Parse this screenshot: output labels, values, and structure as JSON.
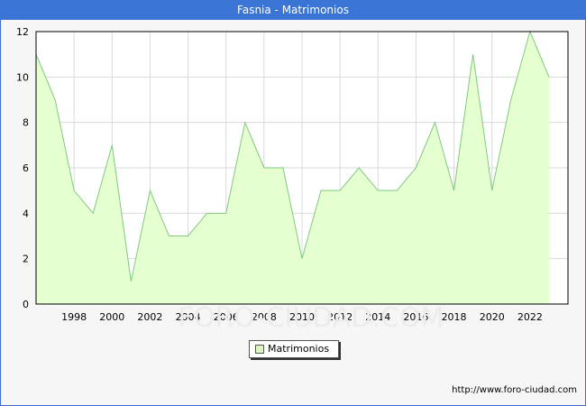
{
  "title": "Fasnia - Matrimonios",
  "source_url": "http://www.foro-ciudad.com",
  "watermark": "FORO-CIUDAD.COM",
  "colors": {
    "title_bg": "#3a75d6",
    "area_fill": "#e6ffd0",
    "area_line": "#80c880",
    "legend_swatch": "#d9f7c0",
    "grid": "#d9d9d9"
  },
  "chart_data": {
    "type": "area",
    "title": "Fasnia - Matrimonios",
    "xlabel": "",
    "ylabel": "",
    "x": [
      1996,
      1997,
      1998,
      1999,
      2000,
      2001,
      2002,
      2003,
      2004,
      2005,
      2006,
      2007,
      2008,
      2009,
      2010,
      2011,
      2012,
      2013,
      2014,
      2015,
      2016,
      2017,
      2018,
      2019,
      2020,
      2021,
      2022,
      2023
    ],
    "series": [
      {
        "name": "Matrimonios",
        "values": [
          11,
          9,
          5,
          4,
          7,
          1,
          5,
          3,
          3,
          4,
          4,
          8,
          6,
          6,
          2,
          5,
          5,
          6,
          5,
          5,
          6,
          8,
          5,
          11,
          5,
          9,
          12,
          10
        ]
      }
    ],
    "xlim": [
      1996,
      2024
    ],
    "ylim": [
      0,
      12
    ],
    "x_ticks": [
      "1998",
      "2000",
      "2002",
      "2004",
      "2006",
      "2008",
      "2010",
      "2012",
      "2014",
      "2016",
      "2018",
      "2020",
      "2022"
    ],
    "y_ticks": [
      "0",
      "2",
      "4",
      "6",
      "8",
      "10",
      "12"
    ],
    "grid": true,
    "legend": "bottom-center"
  }
}
